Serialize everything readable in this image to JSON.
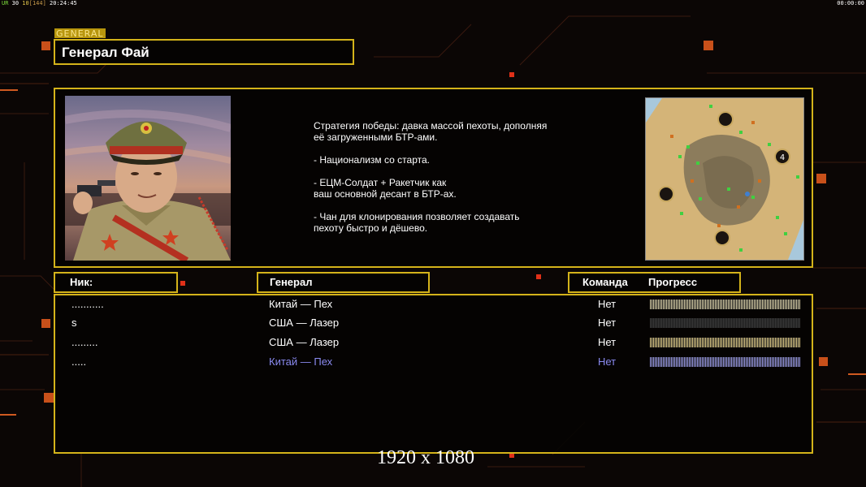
{
  "hud": {
    "left_segments": [
      {
        "text": "UR",
        "color": "green"
      },
      {
        "text": " 30",
        "color": "white"
      },
      {
        "text": " 10",
        "color": "yellow"
      },
      {
        "text": "[144]",
        "color": "orange"
      },
      {
        "text": " 20:24:45",
        "color": "white"
      }
    ],
    "clock_right": "00:00:00"
  },
  "general_tag": "GENERAL",
  "title": "Генерал Фай",
  "description": [
    "Стратегия победы: давка массой пехоты, дополняя\n её загруженными БТР-ами.",
    "- Национализм со старта.",
    "- ЕЦМ-Солдат + Ракетчик как\nваш основной десант в БТР-ах.",
    "- Чан для клонирования позволяет создавать\n пехоту быстро и дёшево."
  ],
  "minimap_marker": "4",
  "headers": {
    "nick": "Ник:",
    "general": "Генерал",
    "team": "Команда",
    "progress": "Прогресс"
  },
  "players": [
    {
      "nick": "...........",
      "general": "Китай — Пех",
      "team": "Нет",
      "progress": 1.0,
      "bar_color": "#d8cfa8"
    },
    {
      "nick": "s",
      "general": "США — Лазер",
      "team": "Нет",
      "progress": 0.0,
      "bar_color": "#3a3a3a"
    },
    {
      "nick": ".........",
      "general": "США — Лазер",
      "team": "Нет",
      "progress": 1.0,
      "bar_color": "#e0cc88"
    },
    {
      "nick": ".....",
      "general": "Китай — Пех",
      "team": "Нет",
      "progress": 1.0,
      "bar_color": "#9a9ae8"
    }
  ],
  "colors": {
    "accent": "#d4b31a",
    "player4": "#8a8af0"
  },
  "resolution_label": "1920 x 1080"
}
